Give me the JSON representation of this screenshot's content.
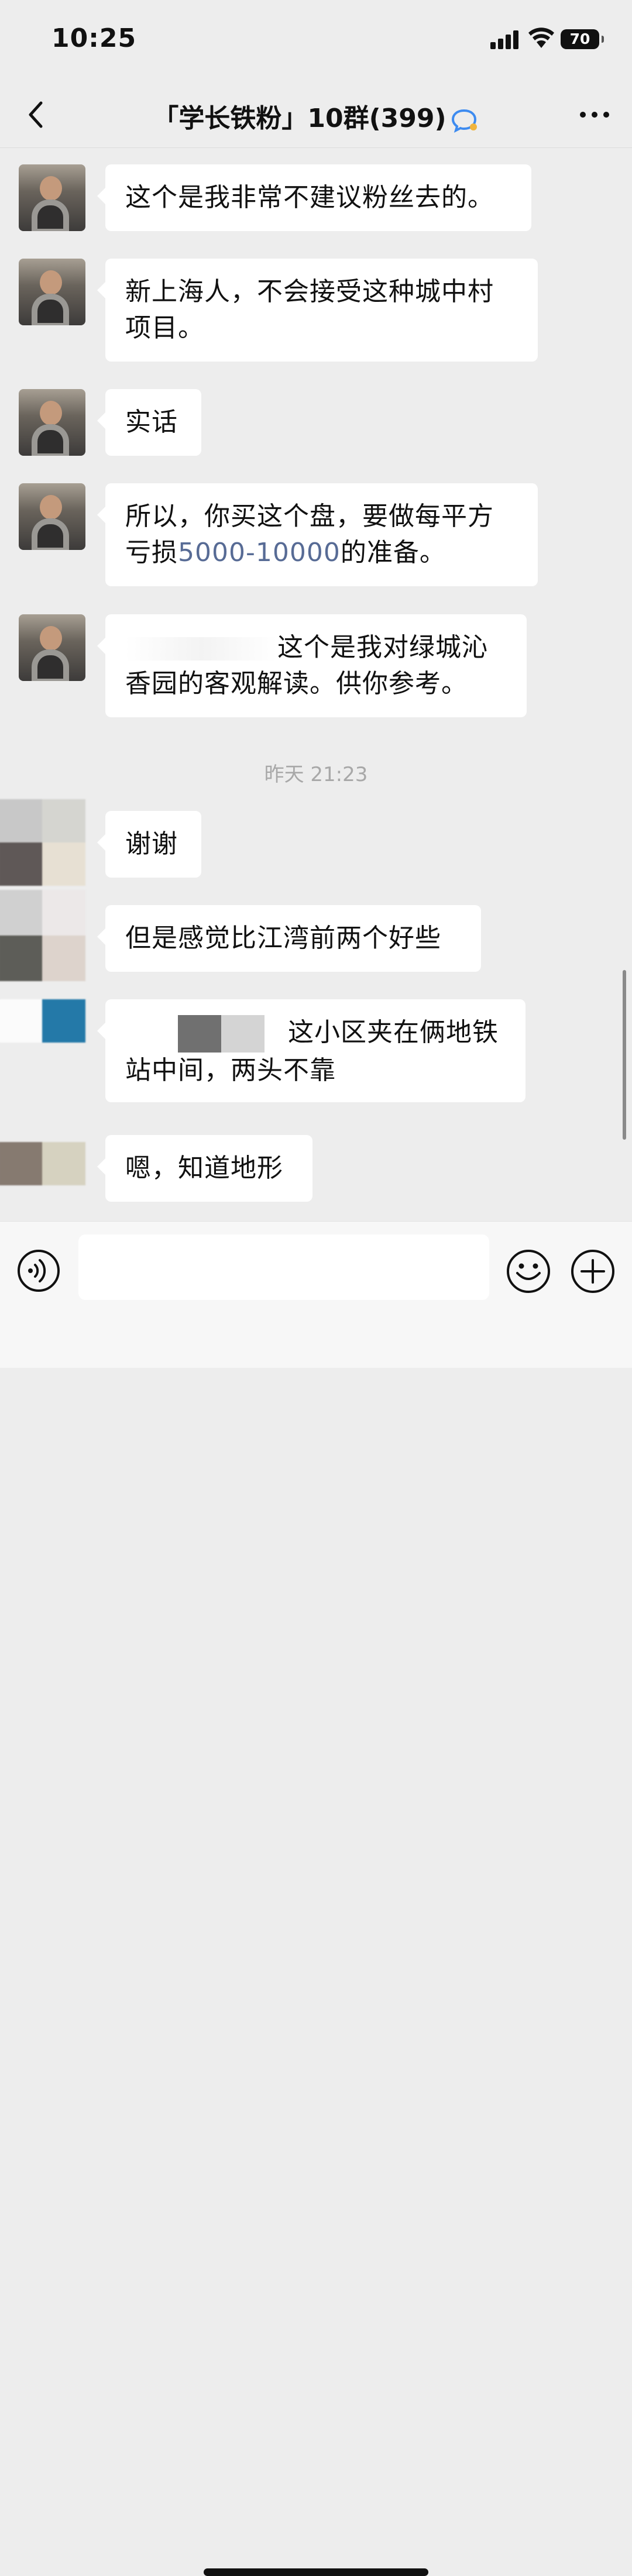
{
  "status_bar": {
    "time": "10:25",
    "battery": "70"
  },
  "nav": {
    "title": "「学长铁粉」10群(399)"
  },
  "messages": [
    {
      "text": "这个是我非常不建议粉丝去的。"
    },
    {
      "text": "新上海人，不会接受这种城中村\n项目。"
    },
    {
      "text": "实话"
    },
    {
      "text_before": "所以，你买这个盘，要做每平方\n亏损",
      "link": "5000-10000",
      "text_after": "的准备。"
    },
    {
      "text": "这个是我对绿城沁\n香园的客观解读。供你参考。"
    },
    {
      "text": "谢谢"
    },
    {
      "text": "但是感觉比江湾前两个好些"
    },
    {
      "text": "这小区夹在俩地铁\n站中间，两头不靠"
    },
    {
      "text": "嗯，知道地形"
    }
  ],
  "timestamp": "昨天 21:23",
  "composer": {
    "placeholder": ""
  },
  "colors": {
    "background": "#ededed",
    "bubble": "#ffffff",
    "link": "#576b95",
    "timestamp": "#a8a8a8"
  }
}
